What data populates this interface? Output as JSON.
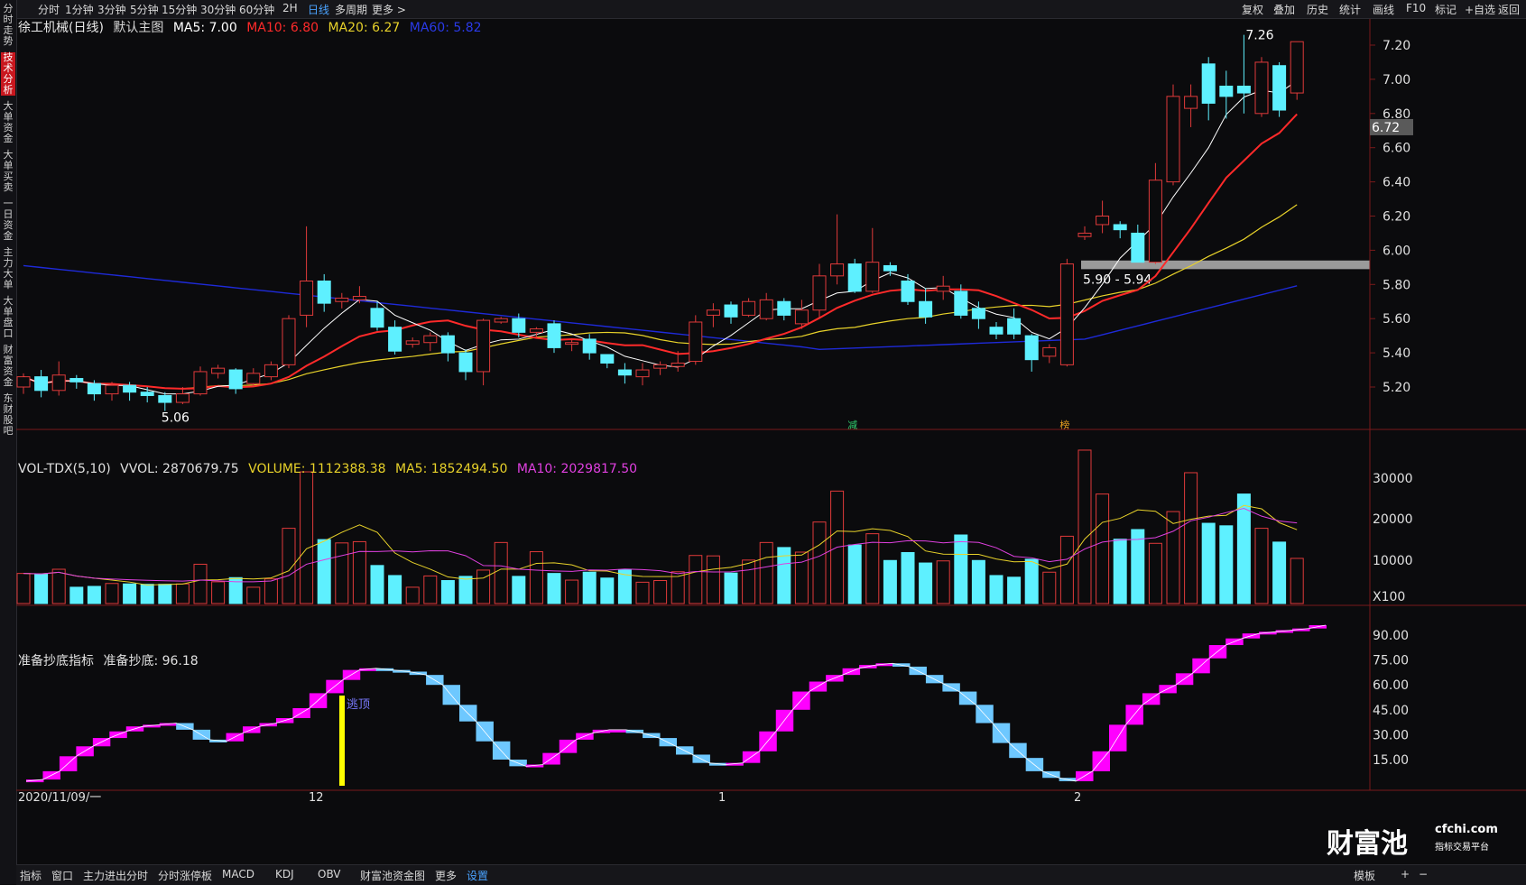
{
  "toolbar": {
    "periods": [
      "分时",
      "1分钟",
      "3分钟",
      "5分钟",
      "15分钟",
      "30分钟",
      "60分钟",
      "2H",
      "日线",
      "多周期",
      "更多 >"
    ],
    "active_period": "日线",
    "right_tools": [
      "复权",
      "叠加",
      "历史",
      "统计",
      "画线",
      "F10",
      "标记",
      "+自选",
      "返回"
    ]
  },
  "leftnav": [
    "分时走势",
    "技术分析",
    "大单资金",
    "大单买卖",
    "一日资金",
    "主力大单",
    "大单盘口",
    "财富资金",
    "东财股吧"
  ],
  "leftnav_active": "技术分析",
  "main_legend": {
    "title": "徐工机械(日线)",
    "mode": "默认主图",
    "ma5": "MA5: 7.00",
    "ma10": "MA10: 6.80",
    "ma20": "MA20: 6.27",
    "ma60": "MA60: 5.82"
  },
  "colors": {
    "ma5": "#ffffff",
    "ma10": "#ff2a2a",
    "ma20": "#e8d22a",
    "ma60": "#1e2ad8",
    "up": "#e03a3a",
    "down": "#5ef0ff",
    "mag": "#ff00ff"
  },
  "price_axis": [
    "7.20",
    "7.00",
    "6.80",
    "6.60",
    "6.40",
    "6.20",
    "6.00",
    "5.80",
    "5.60",
    "5.40",
    "5.20"
  ],
  "current_price": "6.72",
  "annotations": {
    "high": "7.26",
    "low": "5.06",
    "gap": "5.90 - 5.94",
    "mark1": "减",
    "mark2": "榜"
  },
  "vol_legend": {
    "name": "VOL-TDX(5,10)",
    "vvol": "VVOL: 2870679.75",
    "volume": "VOLUME: 1112388.38",
    "ma5": "MA5: 1852494.50",
    "ma10": "MA10: 2029817.50"
  },
  "vol_axis": [
    "30000",
    "20000",
    "10000",
    "X100"
  ],
  "ind_legend": {
    "name": "准备抄底指标",
    "value": "准备抄底: 96.18"
  },
  "ind_axis": [
    "90.00",
    "75.00",
    "60.00",
    "45.00",
    "30.00",
    "15.00"
  ],
  "ind_annotation": "逃顶",
  "date_axis": {
    "start": "2020/11/09/一",
    "m12": "12",
    "m1": "1",
    "m2": "2"
  },
  "bottom_tabs": [
    "指标",
    "窗口",
    "主力进出分时",
    "分时涨停板",
    "MACD",
    "KDJ",
    "OBV",
    "财富池资金图",
    "更多",
    "设置"
  ],
  "bottom_active": "设置",
  "bottom_right": [
    "模板",
    "+",
    "−"
  ],
  "brand": {
    "name": "财富池",
    "domain": "cfchi.com",
    "tagline": "指标交易平台"
  },
  "chart_data": {
    "type": "candlestick",
    "price_range": [
      5.1,
      7.32
    ],
    "candles": [
      [
        5.2,
        5.26,
        5.16,
        5.28
      ],
      [
        5.26,
        5.18,
        5.14,
        5.3
      ],
      [
        5.18,
        5.27,
        5.15,
        5.35
      ],
      [
        5.25,
        5.23,
        5.19,
        5.27
      ],
      [
        5.22,
        5.16,
        5.12,
        5.24
      ],
      [
        5.16,
        5.21,
        5.12,
        5.23
      ],
      [
        5.21,
        5.17,
        5.12,
        5.23
      ],
      [
        5.17,
        5.15,
        5.11,
        5.2
      ],
      [
        5.15,
        5.11,
        5.06,
        5.17
      ],
      [
        5.11,
        5.16,
        5.1,
        5.2
      ],
      [
        5.16,
        5.29,
        5.15,
        5.32
      ],
      [
        5.28,
        5.31,
        5.25,
        5.33
      ],
      [
        5.3,
        5.19,
        5.16,
        5.31
      ],
      [
        5.22,
        5.28,
        5.2,
        5.31
      ],
      [
        5.26,
        5.33,
        5.24,
        5.35
      ],
      [
        5.33,
        5.6,
        5.31,
        5.62
      ],
      [
        5.62,
        5.82,
        5.55,
        6.14
      ],
      [
        5.82,
        5.69,
        5.64,
        5.86
      ],
      [
        5.7,
        5.72,
        5.66,
        5.75
      ],
      [
        5.71,
        5.73,
        5.69,
        5.79
      ],
      [
        5.66,
        5.55,
        5.53,
        5.7
      ],
      [
        5.55,
        5.41,
        5.39,
        5.59
      ],
      [
        5.45,
        5.47,
        5.43,
        5.49
      ],
      [
        5.46,
        5.5,
        5.41,
        5.52
      ],
      [
        5.5,
        5.4,
        5.35,
        5.52
      ],
      [
        5.4,
        5.29,
        5.24,
        5.42
      ],
      [
        5.29,
        5.59,
        5.21,
        5.6
      ],
      [
        5.58,
        5.6,
        5.57,
        5.61
      ],
      [
        5.6,
        5.52,
        5.49,
        5.63
      ],
      [
        5.52,
        5.54,
        5.49,
        5.55
      ],
      [
        5.57,
        5.43,
        5.4,
        5.59
      ],
      [
        5.45,
        5.46,
        5.41,
        5.48
      ],
      [
        5.48,
        5.4,
        5.36,
        5.51
      ],
      [
        5.39,
        5.34,
        5.31,
        5.39
      ],
      [
        5.3,
        5.27,
        5.22,
        5.34
      ],
      [
        5.26,
        5.3,
        5.21,
        5.34
      ],
      [
        5.31,
        5.33,
        5.27,
        5.35
      ],
      [
        5.32,
        5.34,
        5.29,
        5.41
      ],
      [
        5.35,
        5.58,
        5.33,
        5.62
      ],
      [
        5.62,
        5.65,
        5.55,
        5.69
      ],
      [
        5.68,
        5.61,
        5.57,
        5.7
      ],
      [
        5.62,
        5.7,
        5.61,
        5.72
      ],
      [
        5.6,
        5.71,
        5.59,
        5.75
      ],
      [
        5.7,
        5.62,
        5.59,
        5.72
      ],
      [
        5.57,
        5.65,
        5.54,
        5.71
      ],
      [
        5.65,
        5.85,
        5.6,
        5.92
      ],
      [
        5.85,
        5.92,
        5.8,
        6.21
      ],
      [
        5.92,
        5.76,
        5.75,
        5.95
      ],
      [
        5.76,
        5.93,
        5.75,
        6.13
      ],
      [
        5.91,
        5.88,
        5.85,
        5.93
      ],
      [
        5.82,
        5.7,
        5.68,
        5.86
      ],
      [
        5.7,
        5.61,
        5.57,
        5.78
      ],
      [
        5.76,
        5.79,
        5.71,
        5.85
      ],
      [
        5.76,
        5.62,
        5.6,
        5.8
      ],
      [
        5.66,
        5.6,
        5.54,
        5.7
      ],
      [
        5.55,
        5.51,
        5.48,
        5.58
      ],
      [
        5.6,
        5.51,
        5.48,
        5.66
      ],
      [
        5.5,
        5.36,
        5.29,
        5.51
      ],
      [
        5.38,
        5.43,
        5.34,
        5.45
      ],
      [
        5.33,
        5.92,
        5.32,
        5.95
      ],
      [
        6.08,
        6.1,
        6.06,
        6.14
      ],
      [
        6.15,
        6.2,
        6.1,
        6.29
      ],
      [
        6.15,
        6.12,
        6.07,
        6.17
      ],
      [
        6.1,
        5.93,
        5.93,
        6.15
      ],
      [
        5.93,
        6.41,
        5.92,
        6.51
      ],
      [
        6.4,
        6.9,
        6.38,
        6.97
      ],
      [
        6.83,
        6.9,
        6.72,
        6.97
      ],
      [
        7.09,
        6.86,
        6.76,
        7.13
      ],
      [
        6.96,
        6.9,
        6.77,
        7.05
      ],
      [
        6.96,
        6.92,
        6.8,
        7.26
      ],
      [
        6.8,
        7.1,
        6.78,
        7.13
      ],
      [
        7.08,
        6.82,
        6.78,
        7.1
      ],
      [
        6.92,
        7.22,
        6.88,
        7.22
      ]
    ],
    "volume_x100": [
      7200,
      7000,
      8200,
      3900,
      4100,
      4800,
      4700,
      4600,
      4600,
      4700,
      9400,
      5200,
      6200,
      3900,
      5900,
      18000,
      31500,
      15300,
      14500,
      14800,
      9100,
      6700,
      3900,
      6600,
      5500,
      6500,
      8000,
      14600,
      6500,
      12400,
      7200,
      5600,
      7500,
      6100,
      8100,
      5100,
      5500,
      7600,
      11500,
      11400,
      7300,
      10400,
      14600,
      13400,
      12300,
      19500,
      26900,
      14000,
      16700,
      10300,
      12200,
      9700,
      10200,
      16400,
      10300,
      6700,
      6300,
      10600,
      7500,
      16100,
      36700,
      26200,
      15400,
      17700,
      14400,
      22000,
      31300,
      19200,
      18600,
      26200,
      18000,
      14700,
      10800
    ],
    "indicator": [
      2,
      3,
      8,
      17,
      23,
      28,
      32,
      35,
      36,
      37,
      33,
      27,
      26,
      31,
      35,
      37,
      40,
      46,
      55,
      63,
      69,
      70,
      69,
      68,
      66,
      60,
      48,
      38,
      26,
      15,
      11,
      12,
      19,
      27,
      31,
      33,
      33,
      31,
      28,
      23,
      18,
      13,
      12,
      13,
      20,
      32,
      45,
      56,
      62,
      66,
      70,
      72,
      73,
      71,
      66,
      61,
      56,
      48,
      37,
      25,
      16,
      8,
      4,
      2,
      8,
      20,
      36,
      48,
      55,
      60,
      67,
      76,
      84,
      88,
      91,
      92,
      93,
      94,
      96
    ]
  }
}
